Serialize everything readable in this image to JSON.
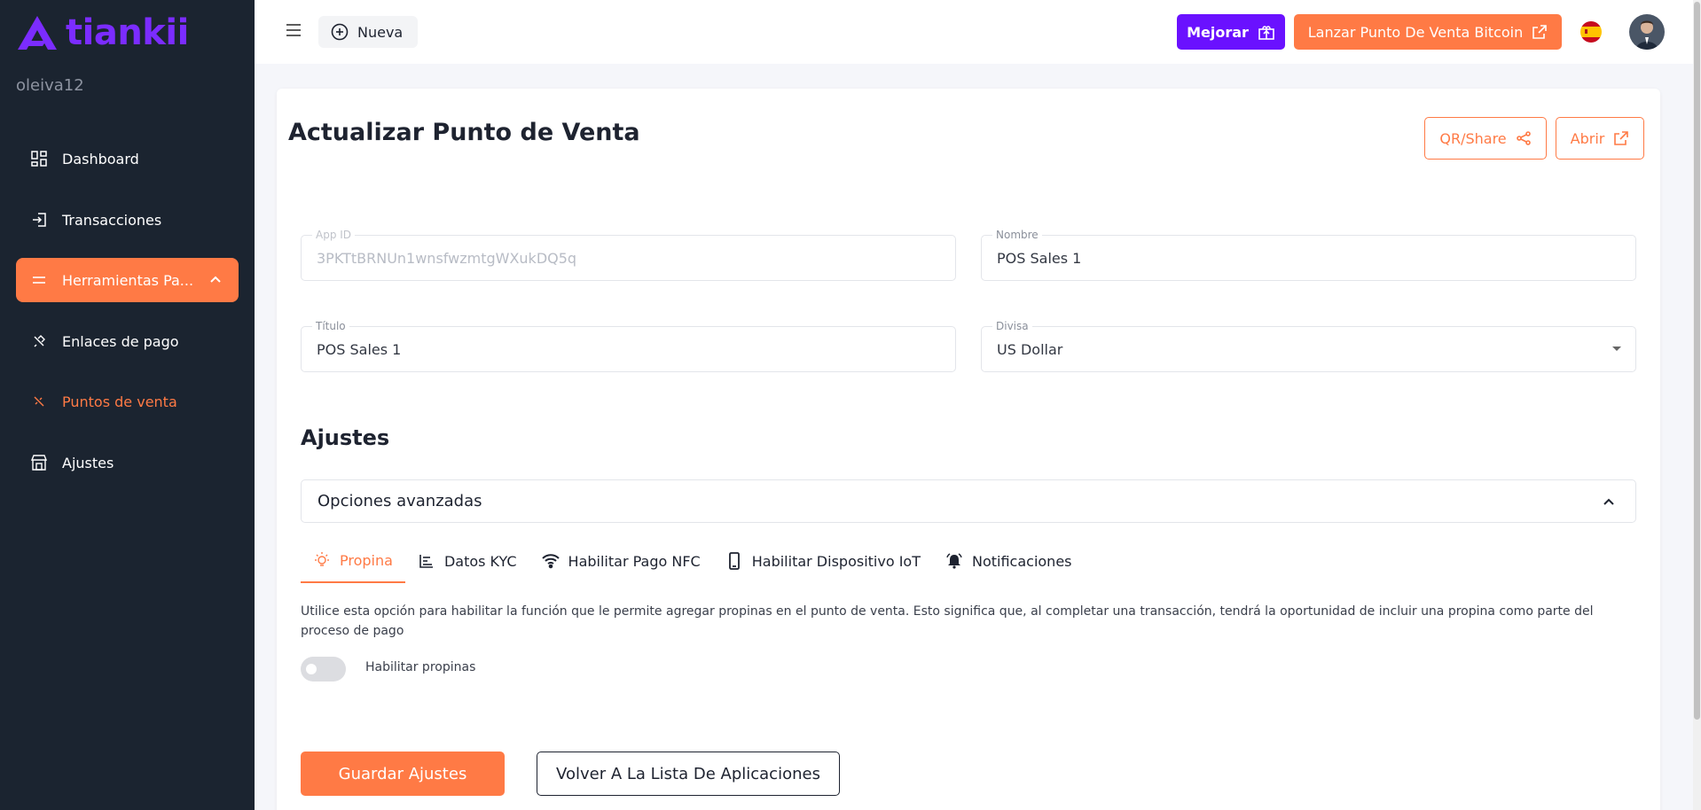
{
  "sidebar": {
    "brand": "tiankii",
    "username": "oleiva12",
    "items": [
      {
        "label": "Dashboard"
      },
      {
        "label": "Transacciones"
      },
      {
        "label": "Herramientas Pa..."
      },
      {
        "label": "Enlaces de pago"
      },
      {
        "label": "Puntos de venta"
      },
      {
        "label": "Ajustes"
      }
    ]
  },
  "topbar": {
    "new_label": "Nueva",
    "upgrade_label": "Mejorar",
    "launch_label": "Lanzar Punto De Venta Bitcoin"
  },
  "page": {
    "title": "Actualizar Punto de Venta",
    "qr_share_label": "QR/Share",
    "open_label": "Abrir"
  },
  "form": {
    "app_id": {
      "label": "App ID",
      "value": "3PKTtBRNUn1wnsfwzmtgWXukDQ5q"
    },
    "nombre": {
      "label": "Nombre",
      "value": "POS Sales 1"
    },
    "titulo": {
      "label": "Título",
      "value": "POS Sales 1"
    },
    "divisa": {
      "label": "Divisa",
      "value": "US Dollar"
    }
  },
  "settings": {
    "section_title": "Ajustes",
    "accordion_label": "Opciones avanzadas",
    "tabs": [
      {
        "label": "Propina"
      },
      {
        "label": "Datos KYC"
      },
      {
        "label": "Habilitar Pago NFC"
      },
      {
        "label": "Habilitar Dispositivo IoT"
      },
      {
        "label": "Notificaciones"
      }
    ],
    "description": "Utilice esta opción para habilitar la función que le permite agregar propinas en el punto de venta. Esto significa que, al completar una transacción, tendrá la oportunidad de incluir una propina como parte del proceso de pago",
    "toggle_label": "Habilitar propinas"
  },
  "actions": {
    "save_label": "Guardar Ajustes",
    "back_label": "Volver A La Lista De Aplicaciones"
  },
  "colors": {
    "accent": "#ff7a45",
    "brand": "#6a11ff",
    "sidebar_bg": "#1b2430"
  }
}
